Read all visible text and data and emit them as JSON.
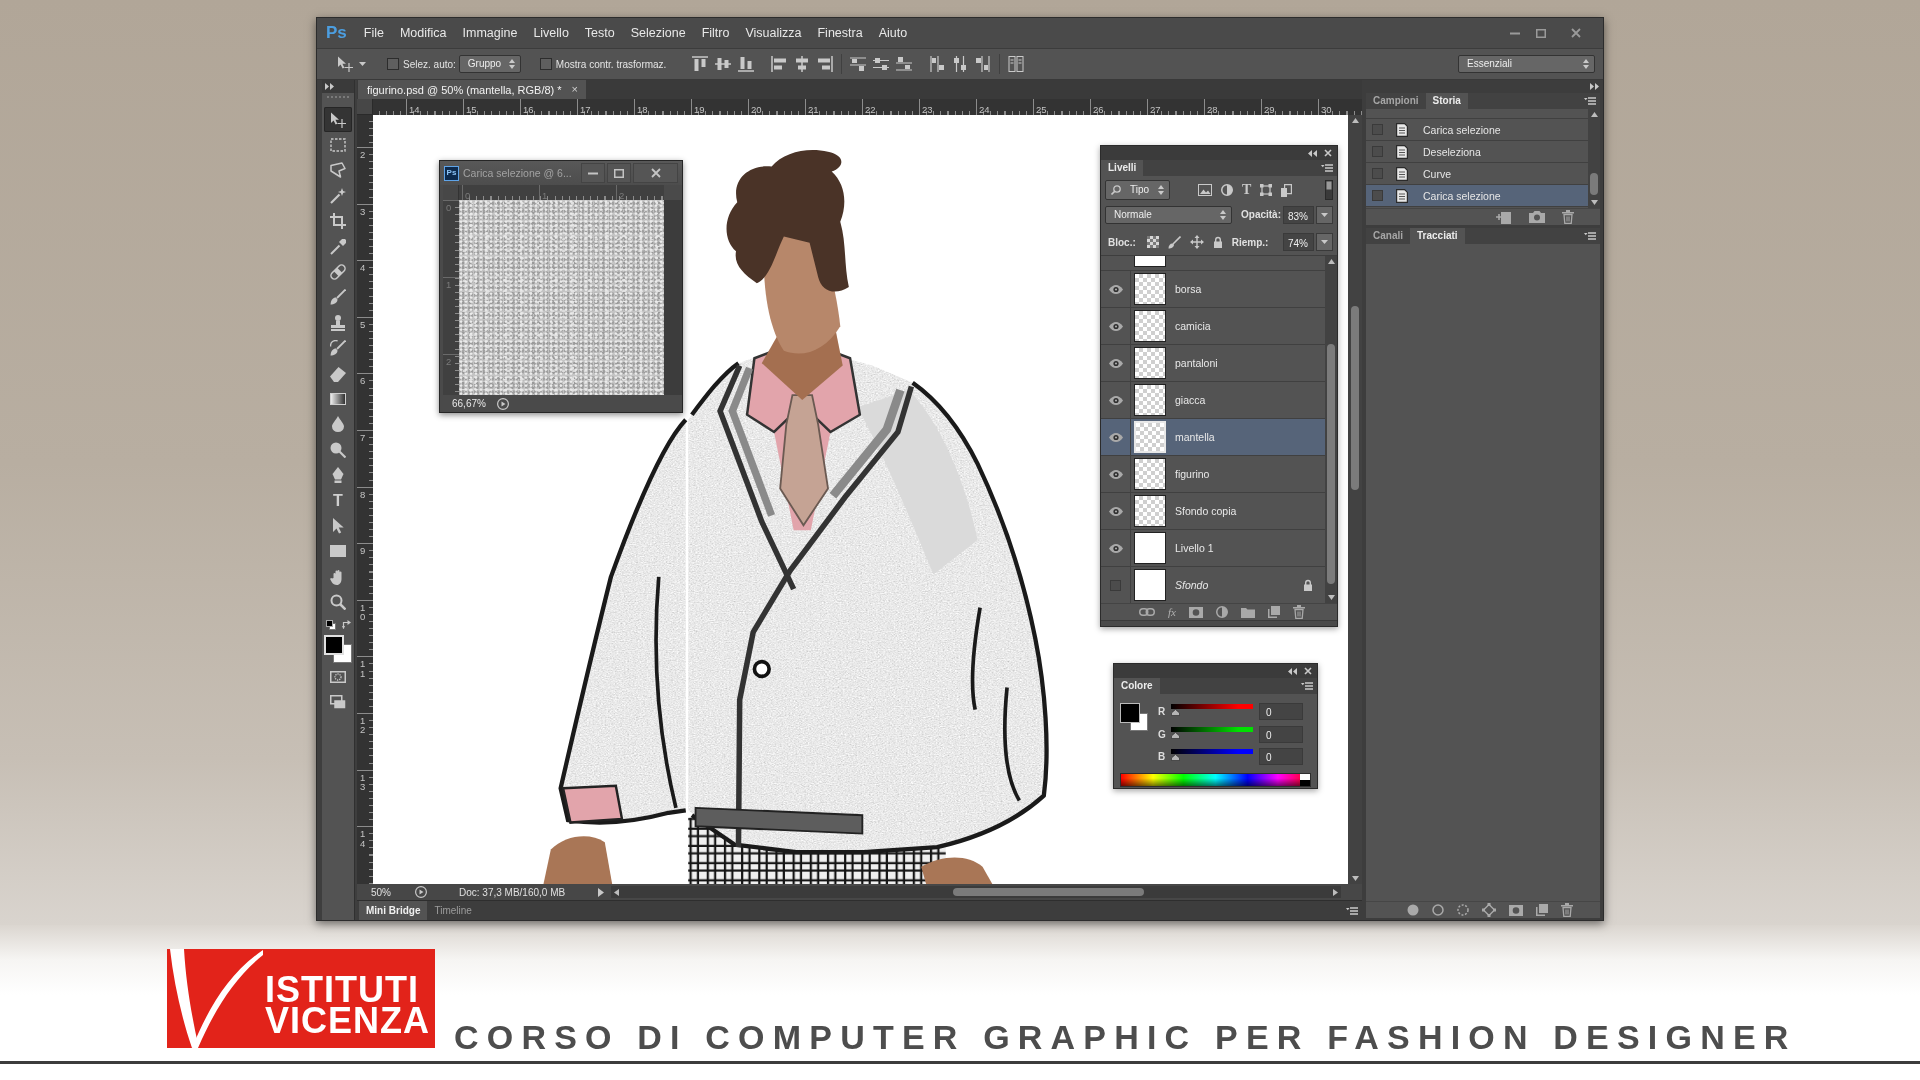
{
  "window": {
    "logo": "Ps",
    "menu": [
      "File",
      "Modifica",
      "Immagine",
      "Livello",
      "Testo",
      "Selezione",
      "Filtro",
      "Visualizza",
      "Finestra",
      "Aiuto"
    ]
  },
  "options_bar": {
    "auto_select": {
      "label": "Selez. auto:",
      "checked": false
    },
    "auto_select_target": "Gruppo",
    "transform_controls": {
      "label": "Mostra contr. trasformaz.",
      "checked": false
    },
    "workspace": "Essenziali"
  },
  "tools": [
    {
      "kind": "move",
      "selected": true
    },
    {
      "kind": "marquee",
      "selected": false
    },
    {
      "kind": "lasso",
      "selected": false
    },
    {
      "kind": "wand",
      "selected": false
    },
    {
      "kind": "crop",
      "selected": false
    },
    {
      "kind": "eyedropper",
      "selected": false
    },
    {
      "kind": "healing",
      "selected": false
    },
    {
      "kind": "brush",
      "selected": false
    },
    {
      "kind": "stamp",
      "selected": false
    },
    {
      "kind": "history",
      "selected": false
    },
    {
      "kind": "eraser",
      "selected": false
    },
    {
      "kind": "gradient",
      "selected": false
    },
    {
      "kind": "blur",
      "selected": false
    },
    {
      "kind": "dodge",
      "selected": false
    },
    {
      "kind": "pen",
      "selected": false
    },
    {
      "kind": "type",
      "label": "T",
      "selected": false
    },
    {
      "kind": "path",
      "selected": false
    },
    {
      "kind": "shape",
      "selected": false
    },
    {
      "kind": "hand",
      "selected": false
    },
    {
      "kind": "zoom",
      "selected": false
    }
  ],
  "document": {
    "tab": {
      "title": "figurino.psd @ 50% (mantella, RGB/8) *",
      "close": "×"
    },
    "ruler_horizontal": [
      "14",
      "15",
      "16",
      "17",
      "18",
      "19",
      "20",
      "21",
      "22",
      "23",
      "24",
      "25",
      "26",
      "27",
      "28",
      "29",
      "30"
    ],
    "ruler_vertical": [
      "2",
      "3",
      "4",
      "5",
      "6",
      "7",
      "8",
      "9",
      "10",
      "11",
      "12",
      "13",
      "14"
    ],
    "zoom": "50%",
    "info": "Doc: 37,3 MB/160,0 MB"
  },
  "bottom_tabs": [
    {
      "label": "Mini Bridge",
      "selected": true
    },
    {
      "label": "Timeline",
      "selected": false
    }
  ],
  "preview_window": {
    "logo": "Ps",
    "title": "Carica selezione @ 6...",
    "ruler_horizontal": [
      "0",
      "1",
      "2"
    ],
    "ruler_vertical": [
      "0",
      "1",
      "2"
    ],
    "zoom": "66,67%"
  },
  "layers_panel": {
    "tabs": [
      {
        "label": "Livelli",
        "selected": true
      }
    ],
    "filter": "Tipo",
    "filter_type_glyph": "T",
    "blend_mode": "Normale",
    "opacity_label": "Opacità:",
    "opacity": "83%",
    "lock_label": "Bloc.:",
    "fill_label": "Riemp.:",
    "fill": "74%",
    "layers": [
      {
        "name": "borsa",
        "kind": "layer",
        "visible": true,
        "transparent": true,
        "selected": false
      },
      {
        "name": "camicia",
        "kind": "layer",
        "visible": true,
        "transparent": true,
        "selected": false
      },
      {
        "name": "pantaloni",
        "kind": "layer",
        "visible": true,
        "transparent": true,
        "selected": false
      },
      {
        "name": "giacca",
        "kind": "layer",
        "visible": true,
        "transparent": true,
        "selected": false
      },
      {
        "name": "mantella",
        "kind": "layer",
        "visible": true,
        "transparent": true,
        "selected": true
      },
      {
        "name": "figurino",
        "kind": "layer",
        "visible": true,
        "transparent": true,
        "selected": false
      },
      {
        "name": "Sfondo copia",
        "kind": "layer",
        "visible": true,
        "transparent": true,
        "selected": false
      },
      {
        "name": "Livello 1",
        "kind": "layer",
        "visible": true,
        "transparent": false,
        "selected": false
      },
      {
        "name": "Sfondo",
        "kind": "background",
        "visible": false,
        "transparent": false,
        "selected": false
      }
    ],
    "style_button": "fx"
  },
  "color_panel": {
    "tabs": [
      {
        "label": "Colore",
        "selected": true
      }
    ],
    "channels": [
      {
        "name": "R",
        "color": "#ff0000",
        "level": 0,
        "reading": "0"
      },
      {
        "name": "G",
        "color": "#00e000",
        "level": 0,
        "reading": "0"
      },
      {
        "name": "B",
        "color": "#0000ff",
        "level": 0,
        "reading": "0"
      }
    ]
  },
  "history_panel": {
    "tabs": [
      {
        "label": "Campioni",
        "selected": false
      },
      {
        "label": "Storia",
        "selected": true
      }
    ],
    "items": [
      {
        "label": "Carica selezione",
        "checked": false,
        "selected": false
      },
      {
        "label": "Deseleziona",
        "checked": false,
        "selected": false
      },
      {
        "label": "Curve",
        "checked": false,
        "selected": false
      },
      {
        "label": "Carica selezione",
        "checked": false,
        "selected": true
      }
    ]
  },
  "paths_panel": {
    "tabs": [
      {
        "label": "Canali",
        "selected": false
      },
      {
        "label": "Tracciati",
        "selected": true
      }
    ]
  },
  "banner": {
    "logo": [
      "ISTITUTI",
      "VICENZA"
    ],
    "title": "CORSO DI COMPUTER GRAPHIC PER FASHION DESIGNER"
  }
}
